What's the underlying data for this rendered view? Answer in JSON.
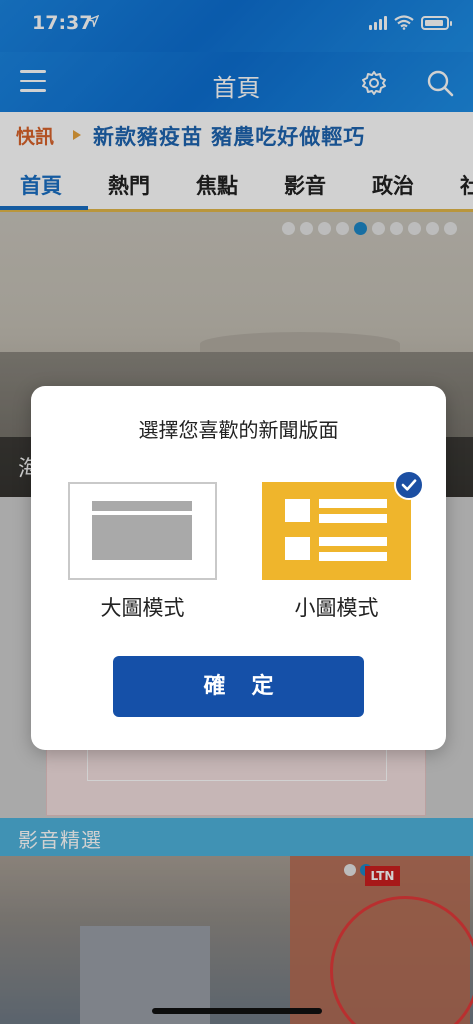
{
  "status_bar": {
    "time": "17:37"
  },
  "nav": {
    "title": "首頁",
    "menu_icon": "hamburger-icon",
    "settings_icon": "gear-icon",
    "search_icon": "search-icon"
  },
  "ticker": {
    "label": "快訊",
    "headline": "新款豬疫苗 豬農吃好做輕巧"
  },
  "tabs": [
    {
      "label": "首頁",
      "active": true
    },
    {
      "label": "熱門"
    },
    {
      "label": "焦點"
    },
    {
      "label": "影音"
    },
    {
      "label": "政治"
    },
    {
      "label": "社"
    }
  ],
  "hero": {
    "caption": "海",
    "dots_total": 10,
    "active_dot": 4
  },
  "video_section": {
    "title": "影音精選",
    "logo": "LTN"
  },
  "dialog": {
    "title": "選擇您喜歡的新聞版面",
    "options": [
      {
        "label": "大圖模式",
        "selected": false
      },
      {
        "label": "小圖模式",
        "selected": true
      }
    ],
    "confirm_label": "確定"
  },
  "colors": {
    "brand_blue": "#1550a8",
    "accent_yellow": "#efb52c",
    "ticker_orange": "#d9632b",
    "video_header": "#4fb3dc"
  }
}
